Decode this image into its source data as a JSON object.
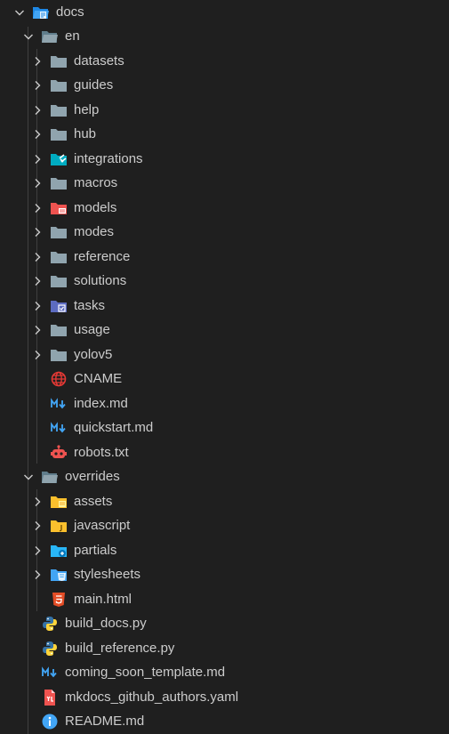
{
  "tree": {
    "root": {
      "label": "docs",
      "icon": "docs-folder-open-icon"
    },
    "en": {
      "label": "en",
      "icon": "folder-open-icon"
    },
    "en_children": [
      {
        "label": "datasets",
        "icon": "folder-icon"
      },
      {
        "label": "guides",
        "icon": "folder-icon"
      },
      {
        "label": "help",
        "icon": "folder-icon"
      },
      {
        "label": "hub",
        "icon": "folder-icon"
      },
      {
        "label": "integrations",
        "icon": "integrations-folder-icon"
      },
      {
        "label": "macros",
        "icon": "folder-icon"
      },
      {
        "label": "models",
        "icon": "models-folder-icon"
      },
      {
        "label": "modes",
        "icon": "folder-icon"
      },
      {
        "label": "reference",
        "icon": "folder-icon"
      },
      {
        "label": "solutions",
        "icon": "folder-icon"
      },
      {
        "label": "tasks",
        "icon": "tasks-folder-icon"
      },
      {
        "label": "usage",
        "icon": "folder-icon"
      },
      {
        "label": "yolov5",
        "icon": "folder-icon"
      }
    ],
    "en_files": [
      {
        "label": "CNAME",
        "icon": "globe-icon"
      },
      {
        "label": "index.md",
        "icon": "markdown-icon"
      },
      {
        "label": "quickstart.md",
        "icon": "markdown-icon"
      },
      {
        "label": "robots.txt",
        "icon": "robot-icon"
      }
    ],
    "overrides": {
      "label": "overrides",
      "icon": "folder-open-icon"
    },
    "overrides_children": [
      {
        "label": "assets",
        "icon": "assets-folder-icon"
      },
      {
        "label": "javascript",
        "icon": "javascript-folder-icon"
      },
      {
        "label": "partials",
        "icon": "partials-folder-icon"
      },
      {
        "label": "stylesheets",
        "icon": "stylesheets-folder-icon"
      }
    ],
    "overrides_files": [
      {
        "label": "main.html",
        "icon": "html5-icon"
      }
    ],
    "root_files": [
      {
        "label": "build_docs.py",
        "icon": "python-icon"
      },
      {
        "label": "build_reference.py",
        "icon": "python-icon"
      },
      {
        "label": "coming_soon_template.md",
        "icon": "markdown-icon"
      },
      {
        "label": "mkdocs_github_authors.yaml",
        "icon": "yaml-icon"
      },
      {
        "label": "README.md",
        "icon": "info-icon"
      }
    ]
  },
  "colors": {
    "background": "#1f1f1f",
    "text": "#cccccc",
    "folder": "#90a4ae",
    "folder_blue": "#42a5f5",
    "folder_red": "#ef5350",
    "folder_purple": "#5c6bc0",
    "folder_yellow": "#fbc02d",
    "markdown": "#42a5f5",
    "python_blue": "#3572a5",
    "python_yellow": "#ffd43b",
    "html": "#e44d26",
    "robot": "#ef5350",
    "globe": "#e53935"
  }
}
